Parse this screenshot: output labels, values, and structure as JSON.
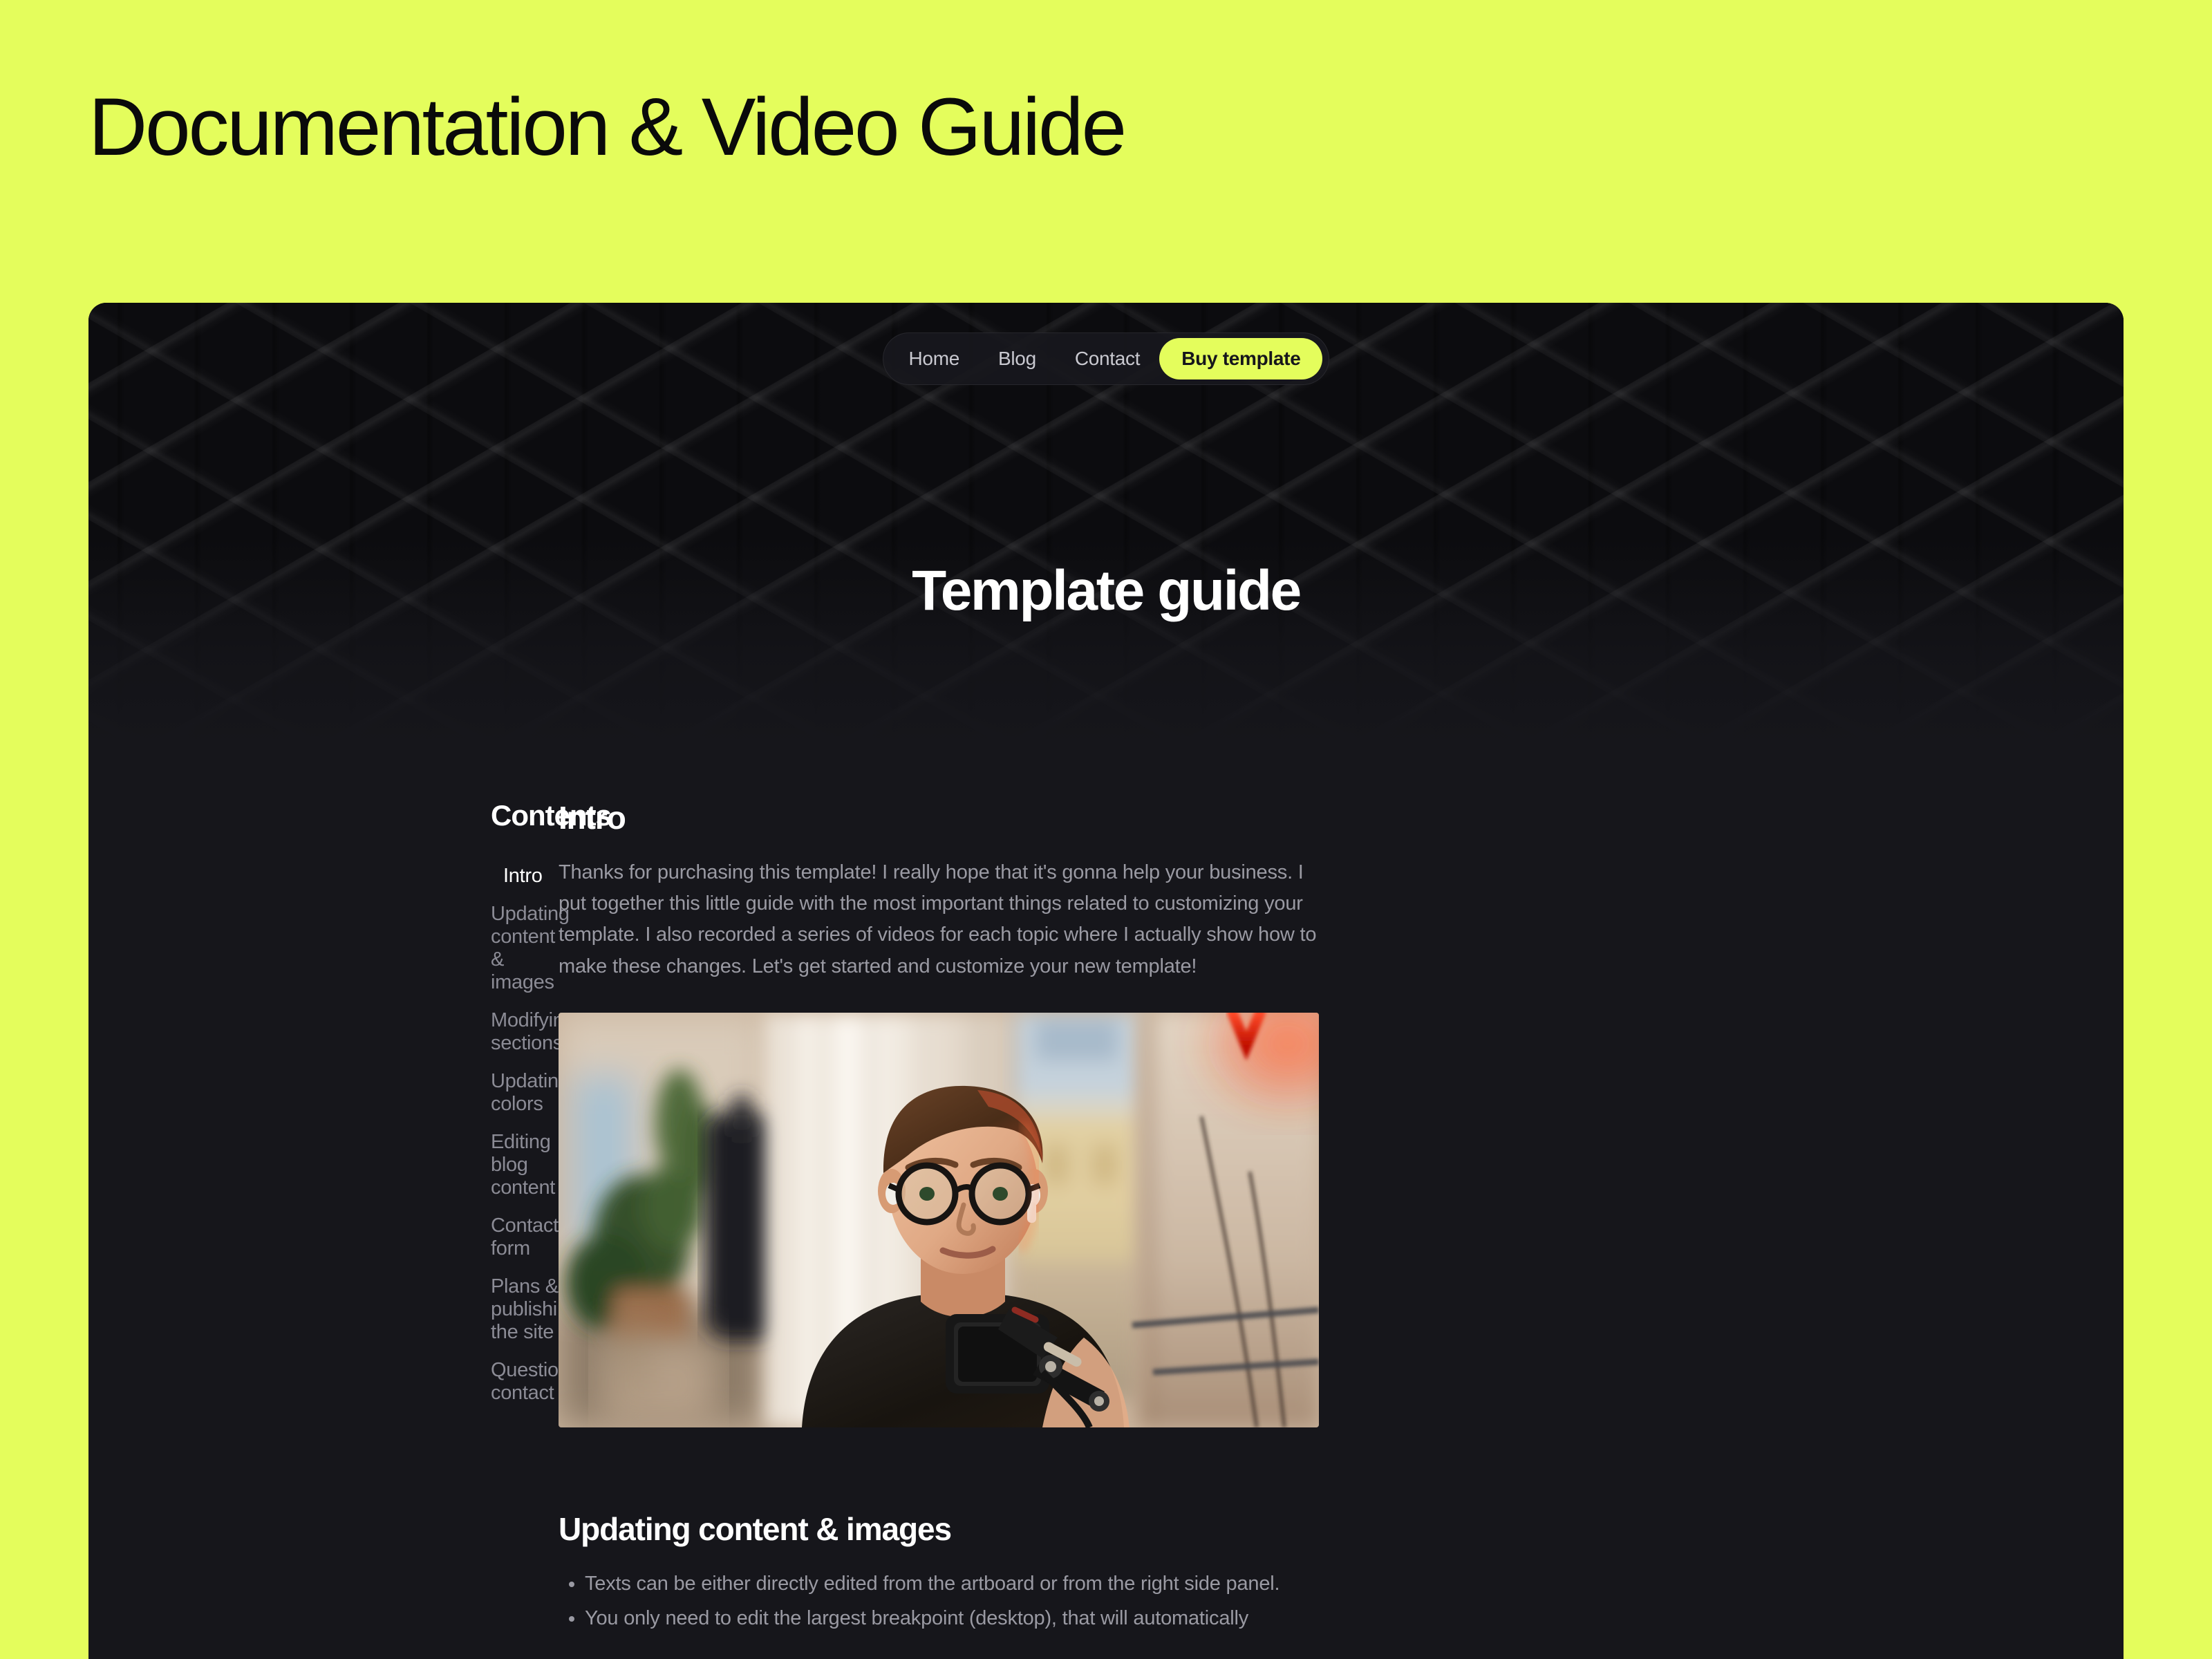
{
  "page": {
    "heading": "Documentation & Video Guide",
    "background_color": "#E4FD5C",
    "panel_color": "#16161B",
    "accent_color": "#E4FD5C"
  },
  "nav": {
    "links": [
      {
        "label": "Home"
      },
      {
        "label": "Blog"
      },
      {
        "label": "Contact"
      }
    ],
    "cta_label": "Buy template"
  },
  "hero": {
    "title": "Template guide"
  },
  "toc": {
    "title": "Contents",
    "items": [
      {
        "label": "Intro",
        "active": true
      },
      {
        "label": "Updating content & images",
        "active": false
      },
      {
        "label": "Modifying sections",
        "active": false
      },
      {
        "label": "Updating colors",
        "active": false
      },
      {
        "label": "Editing blog content",
        "active": false
      },
      {
        "label": "Contact form",
        "active": false
      },
      {
        "label": "Plans & publishing the site",
        "active": false
      },
      {
        "label": "Questions, contact",
        "active": false
      }
    ]
  },
  "article": {
    "intro": {
      "heading": "Intro",
      "body": "Thanks for purchasing this template! I really hope that it's gonna help your business. I put together this little guide with the most important things related to customizing your template. I also recorded a series of videos for each topic where I actually show how to make these changes. Let's get started and customize your new template!"
    },
    "video": {
      "caption": "Intro video thumbnail: person wearing glasses seated at a desk with a microphone, plants and a window behind, red neon sign on the right."
    },
    "updating": {
      "heading": "Updating content & images",
      "bullets": [
        "Texts can be either directly edited from the artboard or from the right side panel.",
        "You only need to edit the largest breakpoint (desktop), that will automatically"
      ]
    }
  }
}
